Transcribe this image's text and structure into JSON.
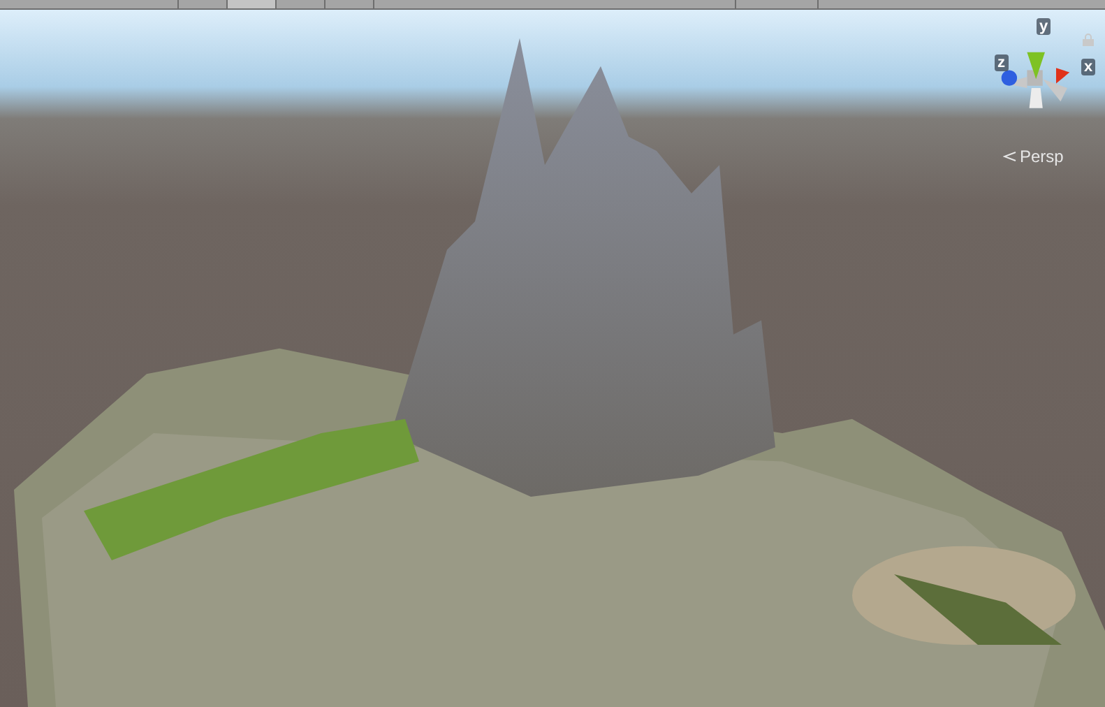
{
  "scene_view": {
    "projection_label": "Persp",
    "gizmo_axes": [
      {
        "kind": "y",
        "label": "y",
        "color": "#7ec224"
      },
      {
        "kind": "z",
        "label": "z",
        "color": "#2e5fe0"
      },
      {
        "kind": "x",
        "label": "x",
        "color": "#e0321a"
      }
    ]
  }
}
